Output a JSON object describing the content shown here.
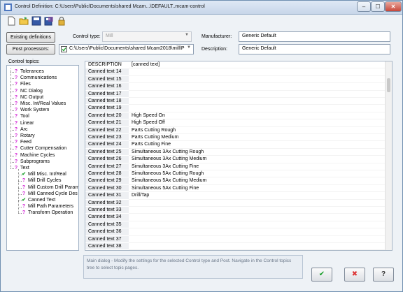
{
  "window": {
    "title": "Control Definition: C:\\Users\\Public\\Documents\\shared Mcam...\\DEFAULT..mcam-control",
    "controls": [
      "–",
      "☐",
      "✕"
    ]
  },
  "toolbar": {
    "icons": [
      "new-icon",
      "open-icon",
      "save-icon",
      "save-as-icon",
      "lock-icon"
    ]
  },
  "buttons": {
    "existing_definitions": "Existing definitions",
    "post_processors": "Post processors:"
  },
  "fields": {
    "control_type_label": "Control type:",
    "control_type_value": "Mill",
    "manufacturer_label": "Manufacturer:",
    "manufacturer_value": "Generic Default",
    "post_path": "C:\\Users\\Public\\Documents\\shared Mcam2018\\mill\\P",
    "description_label": "Description:",
    "description_value": "Generic Default"
  },
  "tree": {
    "label": "Control topics:",
    "items": [
      {
        "label": "Tolerances",
        "mark": "?"
      },
      {
        "label": "Communications",
        "mark": "?"
      },
      {
        "label": "Files",
        "mark": "?"
      },
      {
        "label": "NC Dialog",
        "mark": "?"
      },
      {
        "label": "NC Output",
        "mark": "?"
      },
      {
        "label": "Misc. Int/Real Values",
        "mark": "?"
      },
      {
        "label": "Work System",
        "mark": "?"
      },
      {
        "label": "Tool",
        "mark": "?"
      },
      {
        "label": "Linear",
        "mark": "?"
      },
      {
        "label": "Arc",
        "mark": "?"
      },
      {
        "label": "Rotary",
        "mark": "?"
      },
      {
        "label": "Feed",
        "mark": "?"
      },
      {
        "label": "Cutter Compensation",
        "mark": "?"
      },
      {
        "label": "Machine Cycles",
        "mark": "?"
      },
      {
        "label": "Subprograms",
        "mark": "?"
      },
      {
        "label": "Text",
        "mark": "?"
      }
    ],
    "subitems": [
      {
        "label": "Mill Misc. Int/Real",
        "mark": "✔"
      },
      {
        "label": "Mill Drill Cycles",
        "mark": "?"
      },
      {
        "label": "Mill Custom Drill Param",
        "mark": "?"
      },
      {
        "label": "Mill Canned Cycle Des",
        "mark": "?"
      },
      {
        "label": "Canned Text",
        "mark": "✔"
      },
      {
        "label": "Mill Path Parameters",
        "mark": "?"
      },
      {
        "label": "Transform Operation",
        "mark": "?"
      }
    ]
  },
  "grid": {
    "header": {
      "a": "DESCRIPTION",
      "b": "[canned text]"
    },
    "rows": [
      {
        "a": "Canned text 14",
        "b": ""
      },
      {
        "a": "Canned text 15",
        "b": ""
      },
      {
        "a": "Canned text 16",
        "b": ""
      },
      {
        "a": "Canned text 17",
        "b": ""
      },
      {
        "a": "Canned text 18",
        "b": ""
      },
      {
        "a": "Canned text 19",
        "b": ""
      },
      {
        "a": "Canned text 20",
        "b": "High Speed On"
      },
      {
        "a": "Canned text 21",
        "b": "High Speed Off"
      },
      {
        "a": "Canned text 22",
        "b": "Parts Cutting Rough"
      },
      {
        "a": "Canned text 23",
        "b": "Parts Cutting Medium"
      },
      {
        "a": "Canned text 24",
        "b": "Parts Cutting Fine"
      },
      {
        "a": "Canned text 25",
        "b": "Simultaneous 3Ax Cutting Rough"
      },
      {
        "a": "Canned text 26",
        "b": "Simultaneous 3Ax Cutting Medium"
      },
      {
        "a": "Canned text 27",
        "b": "Simultaneous 3Ax Cutting Fine"
      },
      {
        "a": "Canned text 28",
        "b": "Simultaneous 5Ax Cutting Rough"
      },
      {
        "a": "Canned text 29",
        "b": "Simultaneous 5Ax Cutting Medium"
      },
      {
        "a": "Canned text 30",
        "b": "Simultaneous 5Ax Cutting Fine"
      },
      {
        "a": "Canned text 31",
        "b": "Drill/Tap"
      },
      {
        "a": "Canned text 32",
        "b": ""
      },
      {
        "a": "Canned text 33",
        "b": ""
      },
      {
        "a": "Canned text 34",
        "b": ""
      },
      {
        "a": "Canned text 35",
        "b": ""
      },
      {
        "a": "Canned text 36",
        "b": ""
      },
      {
        "a": "Canned text 37",
        "b": ""
      },
      {
        "a": "Canned text 38",
        "b": ""
      }
    ]
  },
  "hint": "Main dialog - Modify the settings for the selected Control type and Post.  Navigate in the Control topics tree to select topic pages.",
  "bottom": {
    "ok": "✔",
    "cancel": "✖",
    "help": "?"
  }
}
